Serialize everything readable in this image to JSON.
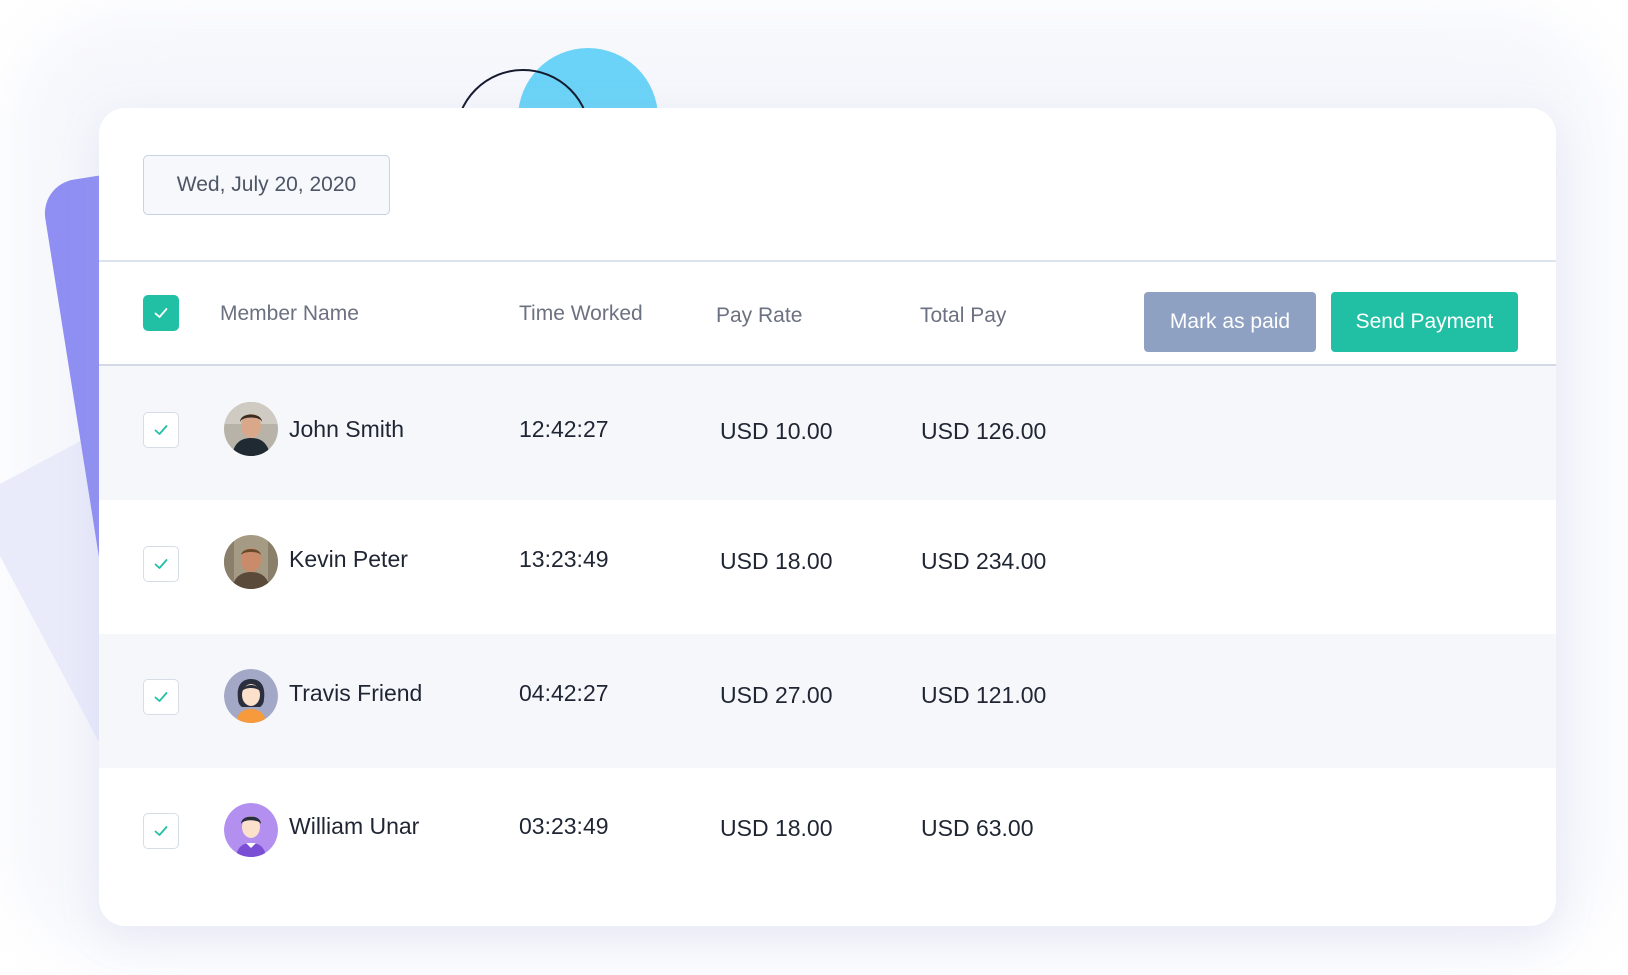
{
  "filters": {
    "date": "Wed, July 20, 2020"
  },
  "table": {
    "columns": {
      "member_name": "Member Name",
      "time_worked": "Time Worked",
      "pay_rate": "Pay Rate",
      "total_pay": "Total Pay"
    },
    "select_all_checked": true,
    "actions": {
      "mark_as_paid": "Mark as paid",
      "send_payment": "Send Payment"
    },
    "rows": [
      {
        "name": "John Smith",
        "time_worked": "12:42:27",
        "pay_rate": "USD 10.00",
        "total_pay": "USD 126.00",
        "checked": true,
        "avatar": "photo-avatar"
      },
      {
        "name": "Kevin Peter",
        "time_worked": "13:23:49",
        "pay_rate": "USD 18.00",
        "total_pay": "USD 234.00",
        "checked": true,
        "avatar": "photo-avatar"
      },
      {
        "name": "Travis Friend",
        "time_worked": "04:42:27",
        "pay_rate": "USD 27.00",
        "total_pay": "USD 121.00",
        "checked": true,
        "avatar": "female-avatar-illustration"
      },
      {
        "name": "William Unar",
        "time_worked": "03:23:49",
        "pay_rate": "USD 18.00",
        "total_pay": "USD 63.00",
        "checked": true,
        "avatar": "male-avatar-illustration"
      }
    ]
  },
  "colors": {
    "accent": "#21c0a4",
    "secondary_button": "#8ea1c2",
    "decor_purple": "#8f8ff3",
    "decor_blue": "#6bd3f7"
  },
  "icons": {
    "checkbox": "check-icon"
  }
}
